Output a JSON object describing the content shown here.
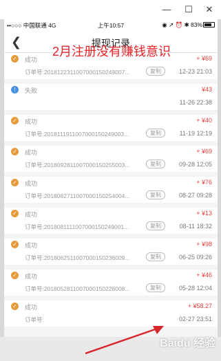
{
  "window": {
    "minimize_glyph": "—",
    "maximize_glyph": "☐",
    "close_glyph": "✕"
  },
  "status_bar": {
    "carrier": "••○○○ 中国联通  4G",
    "time": "上午10:57",
    "indicators": "◉ ↗ ⏰ ✱ 83%"
  },
  "nav": {
    "back_glyph": "❮",
    "title": "提现记录"
  },
  "overlay_caption": "2月注册没有赚钱意识",
  "labels": {
    "copy": "复制"
  },
  "records": [
    {
      "status": "成功",
      "amount": "+ ¥69",
      "order": "订单号:2018122311007000150249007...",
      "time": "12-23 21:03",
      "state": "success"
    },
    {
      "status": "失败",
      "amount": "¥43",
      "order": "",
      "time": "11-26 22:38",
      "state": "fail"
    },
    {
      "status": "成功",
      "amount": "+ ¥40",
      "order": "订单号:2018111911007000150249003...",
      "time": "11-19 12:19",
      "state": "success"
    },
    {
      "status": "成功",
      "amount": "+ ¥69",
      "order": "订单号:2018092811007000150255003...",
      "time": "09-28 12:05",
      "state": "success"
    },
    {
      "status": "成功",
      "amount": "+ ¥76",
      "order": "订单号:2018082711007000150254004...",
      "time": "08-27 09:28",
      "state": "success"
    },
    {
      "status": "成功",
      "amount": "+ ¥13",
      "order": "订单号:2018081111007000150249001...",
      "time": "08-11 18:32",
      "state": "success"
    },
    {
      "status": "成功",
      "amount": "+ ¥98",
      "order": "订单号:2018062511007000150236009...",
      "time": "06-25 09:26",
      "state": "success"
    },
    {
      "status": "成功",
      "amount": "+ ¥46",
      "order": "订单号:2018052811007000150228008...",
      "time": "05-28 12:04",
      "state": "success"
    },
    {
      "status": "成功",
      "amount": "+ ¥58.27",
      "order": "订单号:",
      "time": "02-27 23:51",
      "state": "success"
    }
  ],
  "watermark": "Baidu 经验",
  "colors": {
    "success": "#e59b3a",
    "fail": "#4a90e2",
    "amount": "#e2413c",
    "caption": "#e8232a"
  },
  "icons": {
    "success": "check-circle-icon",
    "fail": "info-circle-icon"
  }
}
